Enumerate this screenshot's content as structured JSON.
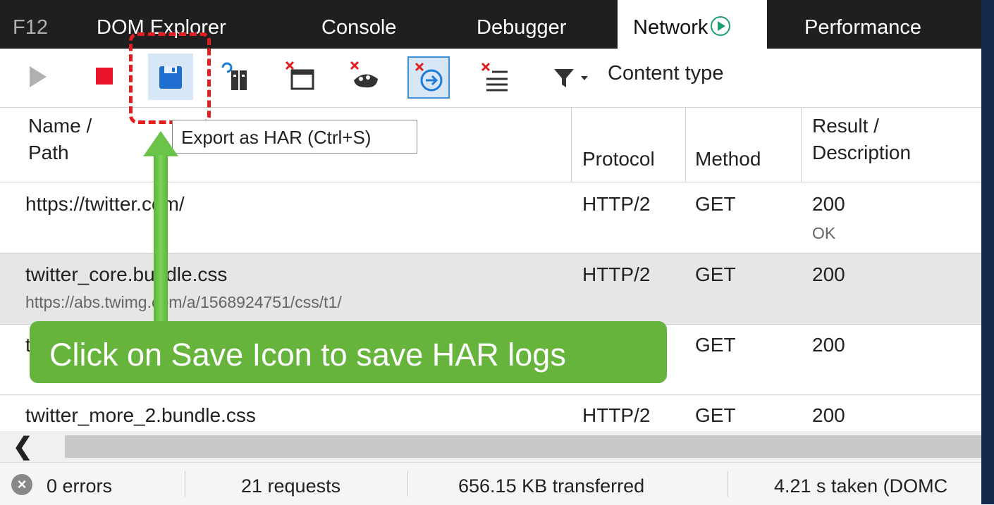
{
  "tabs": [
    {
      "label": "F12"
    },
    {
      "label": "DOM Explorer"
    },
    {
      "label": "Console"
    },
    {
      "label": "Debugger"
    },
    {
      "label": "Network"
    },
    {
      "label": "Performance"
    }
  ],
  "toolbar": {
    "content_type_label": "Content type",
    "tooltip": "Export as HAR (Ctrl+S)",
    "icons": [
      "play-icon",
      "stop-icon",
      "save-icon",
      "clear-cache-icon",
      "clear-cookies-icon",
      "clear-session-icon",
      "clear-on-navigate-icon",
      "clear-entries-icon",
      "filter-icon"
    ]
  },
  "table": {
    "headers": {
      "name": [
        "Name /",
        "Path"
      ],
      "protocol": "Protocol",
      "method": "Method",
      "result": [
        "Result /",
        "Description"
      ]
    },
    "rows": [
      {
        "name": "https://twitter.com/",
        "path": "",
        "protocol": "HTTP/2",
        "method": "GET",
        "result": "200",
        "description": "OK"
      },
      {
        "name": "twitter_core.bundle.css",
        "path": "https://abs.twimg.com/a/1568924751/css/t1/",
        "protocol": "HTTP/2",
        "method": "GET",
        "result": "200",
        "description": ""
      },
      {
        "name": "t",
        "path": "",
        "protocol": "",
        "method": "GET",
        "result": "200",
        "description": ""
      },
      {
        "name": "twitter_more_2.bundle.css",
        "path": "",
        "protocol": "HTTP/2",
        "method": "GET",
        "result": "200",
        "description": ""
      }
    ]
  },
  "status": {
    "errors": "0 errors",
    "requests": "21 requests",
    "transferred": "656.15 KB transferred",
    "taken": "4.21 s taken (DOMC"
  },
  "annotation": {
    "callout": "Click on Save Icon to save HAR logs"
  },
  "colors": {
    "callout_green": "#67b43d",
    "highlight_red": "#e02020",
    "accent_blue": "#1e7bd6"
  }
}
